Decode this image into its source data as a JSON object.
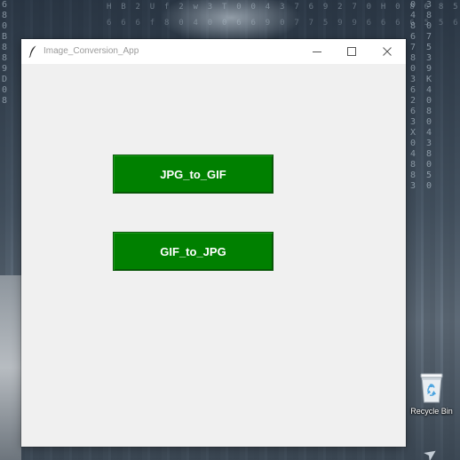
{
  "window": {
    "title": "Image_Conversion_App",
    "controls": {
      "minimize": "minimize-icon",
      "maximize": "maximize-icon",
      "close": "close-icon"
    }
  },
  "main": {
    "buttons": [
      {
        "label": "JPG_to_GIF"
      },
      {
        "label": "GIF_to_JPG"
      }
    ],
    "button_color": "#008000",
    "button_text_color": "#ffffff",
    "background_color": "#f0f0f0"
  },
  "desktop": {
    "icons": [
      {
        "label": "Recycle Bin",
        "icon": "recycle-bin-icon"
      }
    ]
  }
}
